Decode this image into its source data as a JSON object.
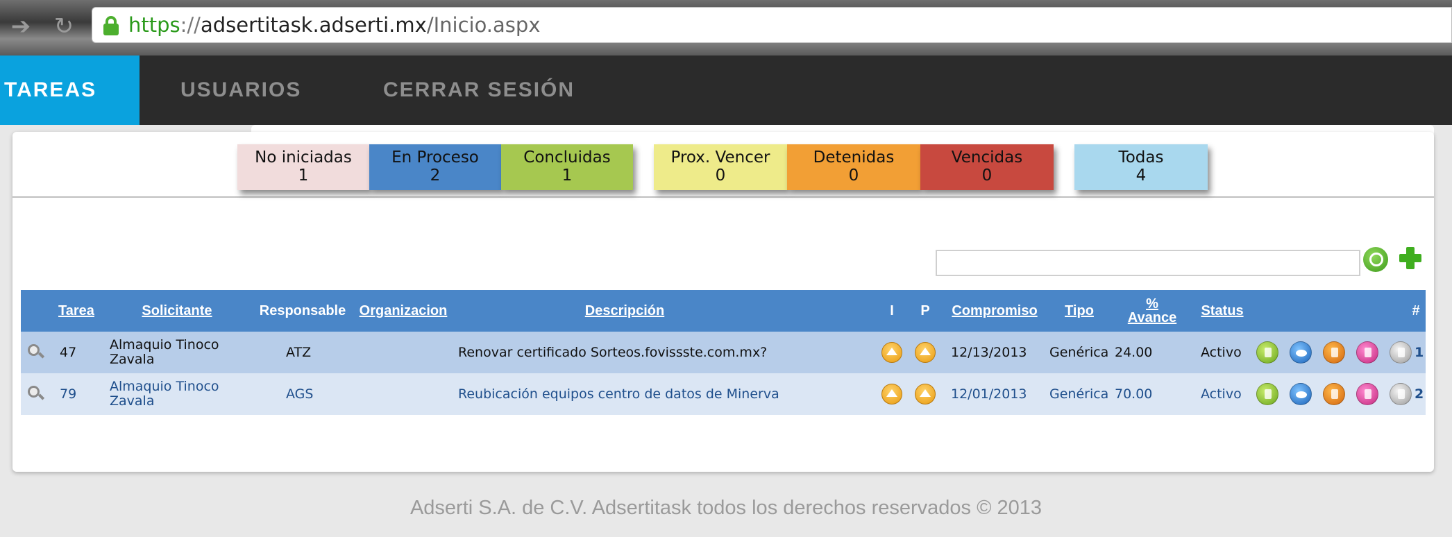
{
  "browser": {
    "url_protocol": "https",
    "url_separator": "://",
    "url_host": "adsertitask.adserti.mx",
    "url_path": "/Inicio.aspx",
    "back_icon": "arrow-right-icon",
    "reload_icon": "reload-icon"
  },
  "nav": {
    "tabs": [
      {
        "label": "TAREAS",
        "active": true
      },
      {
        "label": "USUARIOS",
        "active": false
      },
      {
        "label": "CERRAR SESIÓN",
        "active": false
      }
    ]
  },
  "filters": [
    {
      "label": "No iniciadas",
      "count": "1",
      "color": "#f1dcdc"
    },
    {
      "label": "En Proceso",
      "count": "2",
      "color": "#4a86c8"
    },
    {
      "label": "Concluidas",
      "count": "1",
      "color": "#a6c850"
    },
    {
      "label": "Prox. Vencer",
      "count": "0",
      "color": "#eeeb8a"
    },
    {
      "label": "Detenidas",
      "count": "0",
      "color": "#f29f35"
    },
    {
      "label": "Vencidas",
      "count": "0",
      "color": "#c8493f"
    },
    {
      "label": "Todas",
      "count": "4",
      "color": "#a9d8ee"
    }
  ],
  "search": {
    "placeholder": "",
    "value": ""
  },
  "table": {
    "headers": {
      "tarea": "Tarea",
      "solicitante": "Solicitante",
      "responsable": "Responsable",
      "organizacion": "Organizacion",
      "descripcion": "Descripción",
      "i": "I",
      "p": "P",
      "compromiso": "Compromiso",
      "tipo": "Tipo",
      "avance_line1": "%",
      "avance_line2": "Avance",
      "status": "Status",
      "num": "#"
    },
    "rows": [
      {
        "tarea": "47",
        "solicitante_line1": "Almaquio Tinoco",
        "solicitante_line2": "Zavala",
        "responsable": "ATZ",
        "organizacion": "",
        "descripcion": "Renovar certificado Sorteos.fovissste.com.mx?",
        "compromiso": "12/13/2013",
        "tipo": "Genérica",
        "avance": "24.00",
        "status": "Activo",
        "num": "1"
      },
      {
        "tarea": "79",
        "solicitante_line1": "Almaquio Tinoco",
        "solicitante_line2": "Zavala",
        "responsable": "AGS",
        "organizacion": "",
        "descripcion": "Reubicación equipos centro de datos de Minerva",
        "compromiso": "12/01/2013",
        "tipo": "Genérica",
        "avance": "70.00",
        "status": "Activo",
        "num": "2"
      }
    ]
  },
  "footer": {
    "text": "Adserti S.A. de C.V. Adsertitask todos los derechos reservados © 2013"
  },
  "colors": {
    "nav_bg": "#2b2b2b",
    "nav_active": "#0aa2de",
    "table_header": "#4a86c8"
  }
}
